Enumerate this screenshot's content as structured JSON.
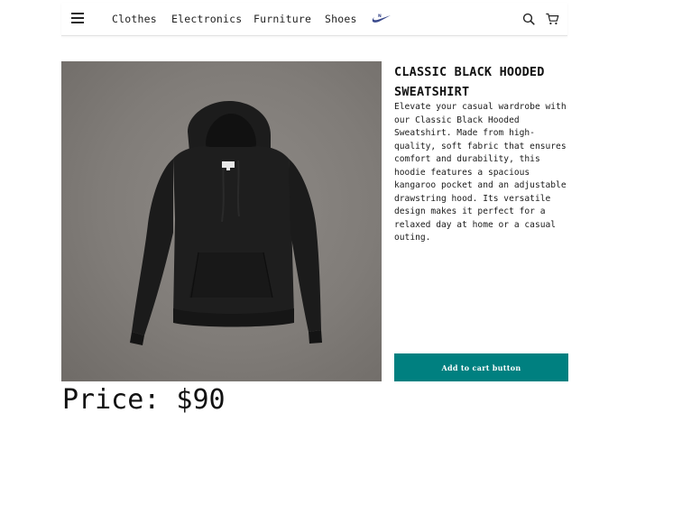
{
  "navbar": {
    "menu_icon": "hamburger-menu-icon",
    "links": [
      {
        "label": "Clothes"
      },
      {
        "label": "Electronics"
      },
      {
        "label": "Furniture"
      },
      {
        "label": "Shoes"
      }
    ],
    "brand_icon": "nike-swoosh-logo",
    "search_icon": "search-icon",
    "cart_icon": "shopping-cart-icon"
  },
  "product": {
    "title": "CLASSIC BLACK HOODED SWEATSHIRT",
    "description": "Elevate your casual wardrobe with our Classic Black Hooded Sweatshirt. Made from high-quality, soft fabric that ensures comfort and durability, this hoodie features a spacious kangaroo pocket and an adjustable drawstring hood. Its versatile design makes it perfect for a relaxed day at home or a casual outing.",
    "image_subject": "black hooded sweatshirt on gray background",
    "add_to_cart_label": "Add to cart button",
    "price_text": "Price: $90"
  },
  "colors": {
    "accent": "#008080",
    "image_background": "#807c78",
    "hoodie": "#1c1c1c",
    "brand_logo": "#3b4a8c"
  }
}
